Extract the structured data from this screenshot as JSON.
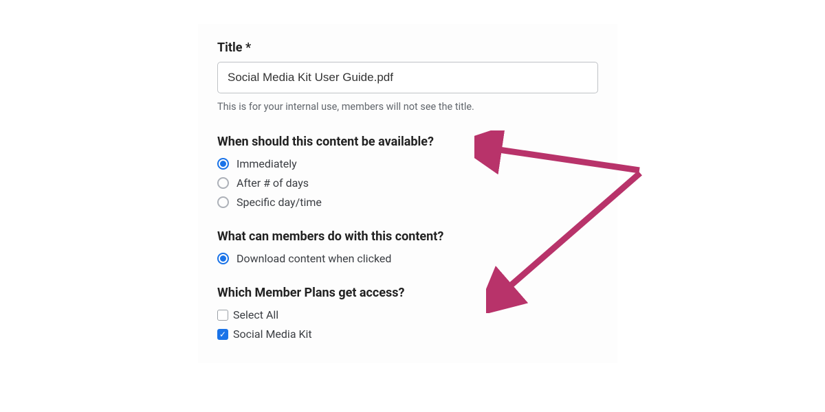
{
  "title_field": {
    "label": "Title *",
    "value": "Social Media Kit User Guide.pdf",
    "helper": "This is for your internal use, members will not see the title."
  },
  "availability": {
    "heading": "When should this content be available?",
    "options": [
      {
        "label": "Immediately",
        "selected": true
      },
      {
        "label": "After # of days",
        "selected": false
      },
      {
        "label": "Specific day/time",
        "selected": false
      }
    ]
  },
  "actions": {
    "heading": "What can members do with this content?",
    "options": [
      {
        "label": "Download content when clicked",
        "selected": true
      }
    ]
  },
  "plans": {
    "heading": "Which Member Plans get access?",
    "options": [
      {
        "label": "Select All",
        "checked": false
      },
      {
        "label": "Social Media Kit",
        "checked": true
      }
    ]
  },
  "colors": {
    "accent": "#1a73e8",
    "annotation": "#b8336a"
  }
}
